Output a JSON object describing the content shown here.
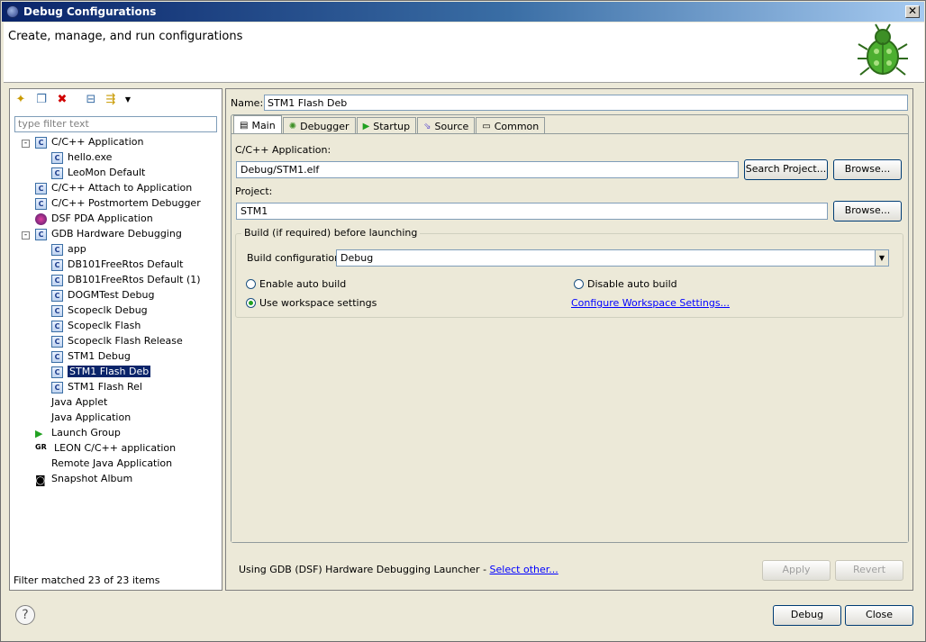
{
  "window": {
    "title": "Debug Configurations"
  },
  "header": {
    "title": "Create, manage, and run configurations"
  },
  "left": {
    "filter_placeholder": "type filter text",
    "status": "Filter matched 23 of 23 items",
    "tree": [
      {
        "label": "C/C++ Application",
        "level": 0,
        "expand": "-",
        "icon": "c-app-icon"
      },
      {
        "label": "hello.exe",
        "level": 1,
        "icon": "c-config-icon"
      },
      {
        "label": "LeoMon Default",
        "level": 1,
        "icon": "c-config-icon"
      },
      {
        "label": "C/C++ Attach to Application",
        "level": 0,
        "icon": "c-app-icon"
      },
      {
        "label": "C/C++ Postmortem Debugger",
        "level": 0,
        "icon": "c-app-icon"
      },
      {
        "label": "DSF PDA Application",
        "level": 0,
        "icon": "pda-icon"
      },
      {
        "label": "GDB Hardware Debugging",
        "level": 0,
        "expand": "-",
        "icon": "c-app-icon"
      },
      {
        "label": "app",
        "level": 1,
        "icon": "c-config-icon"
      },
      {
        "label": "DB101FreeRtos Default",
        "level": 1,
        "icon": "c-config-icon"
      },
      {
        "label": "DB101FreeRtos Default (1)",
        "level": 1,
        "icon": "c-config-icon"
      },
      {
        "label": "DOGMTest Debug",
        "level": 1,
        "icon": "c-config-icon"
      },
      {
        "label": "Scopeclk Debug",
        "level": 1,
        "icon": "c-config-icon"
      },
      {
        "label": "Scopeclk Flash",
        "level": 1,
        "icon": "c-config-icon"
      },
      {
        "label": "Scopeclk Flash Release",
        "level": 1,
        "icon": "c-config-icon"
      },
      {
        "label": "STM1 Debug",
        "level": 1,
        "icon": "c-config-icon"
      },
      {
        "label": "STM1 Flash Deb",
        "level": 1,
        "icon": "c-config-icon",
        "selected": true
      },
      {
        "label": "STM1 Flash Rel",
        "level": 1,
        "icon": "c-config-icon"
      },
      {
        "label": "Java Applet",
        "level": 0,
        "icon": ""
      },
      {
        "label": "Java Application",
        "level": 0,
        "icon": ""
      },
      {
        "label": "Launch Group",
        "level": 0,
        "icon": "launch-group-icon"
      },
      {
        "label": "LEON C/C++ application",
        "level": 0,
        "icon": "leon-icon"
      },
      {
        "label": "Remote Java Application",
        "level": 0,
        "icon": ""
      },
      {
        "label": "Snapshot Album",
        "level": 0,
        "icon": "camera-icon"
      }
    ]
  },
  "config": {
    "name_label": "Name:",
    "name_value": "STM1 Flash Deb",
    "tabs": [
      "Main",
      "Debugger",
      "Startup",
      "Source",
      "Common"
    ],
    "app_label": "C/C++ Application:",
    "app_value": "Debug/STM1.elf",
    "search_project": "Search Project...",
    "browse1": "Browse...",
    "project_label": "Project:",
    "project_value": "STM1",
    "browse2": "Browse...",
    "group_title": "Build (if required) before launching",
    "build_config_label": "Build configuration:",
    "build_config_value": "Debug",
    "enable_auto": "Enable auto build",
    "disable_auto": "Disable auto build",
    "use_workspace": "Use workspace settings",
    "configure_link": "Configure Workspace Settings...",
    "launcher_text": "Using GDB (DSF) Hardware Debugging Launcher - ",
    "select_other": "Select other...",
    "apply": "Apply",
    "revert": "Revert"
  },
  "footer": {
    "debug": "Debug",
    "close": "Close",
    "help": "?"
  }
}
